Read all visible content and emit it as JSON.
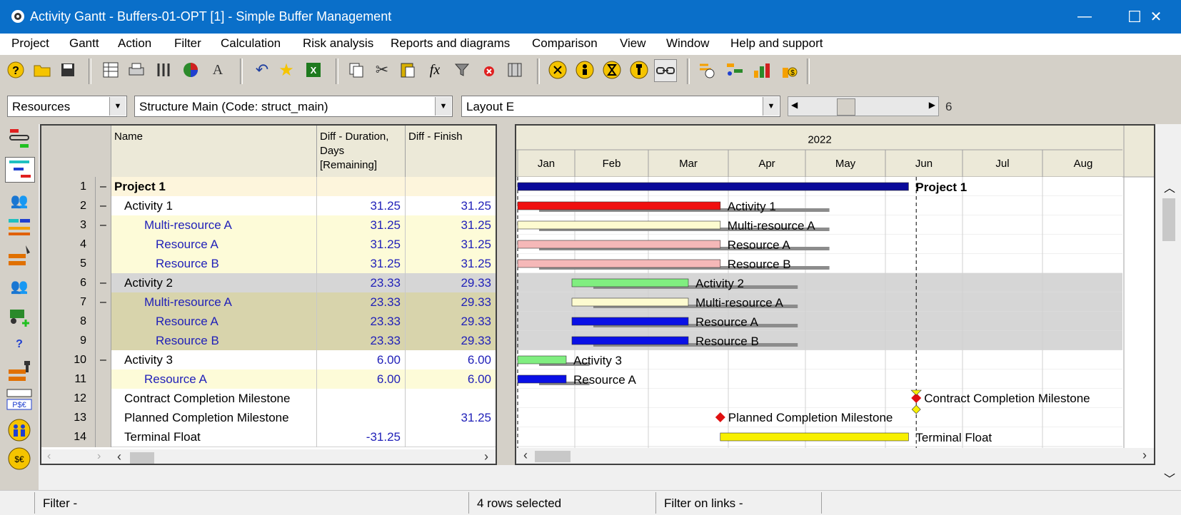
{
  "window": {
    "title": "Activity Gantt - Buffers-01-OPT [1] - Simple Buffer Management",
    "minimize": "—",
    "maximize": "☐",
    "close": "✕"
  },
  "menu": [
    "Project",
    "Gantt",
    "Action",
    "Filter",
    "Calculation",
    "Risk analysis",
    "Reports and diagrams",
    "Comparison",
    "View",
    "Window",
    "Help and support"
  ],
  "selectors": {
    "view": "Resources",
    "structure": "Structure Main (Code: struct_main)",
    "layout": "Layout E",
    "zoom_value": "6"
  },
  "grid": {
    "headers": {
      "name": "Name",
      "duration": "Diff - Duration, Days [Remaining]",
      "finish": "Diff - Finish"
    },
    "rows": [
      {
        "num": "1",
        "collapse": "–",
        "name": "Project 1",
        "dur": "",
        "fin": "",
        "indent": 0,
        "bold": true,
        "bg": "#fdf5dc",
        "color": "#000"
      },
      {
        "num": "2",
        "collapse": "–",
        "name": "Activity 1",
        "dur": "31.25",
        "fin": "31.25",
        "indent": 1,
        "bold": false,
        "bg": "#ffffff",
        "color": "#000"
      },
      {
        "num": "3",
        "collapse": "–",
        "name": "Multi-resource A",
        "dur": "31.25",
        "fin": "31.25",
        "indent": 2,
        "bold": false,
        "bg": "#fdfbd8",
        "color": "#1f1fb8"
      },
      {
        "num": "4",
        "collapse": "",
        "name": "Resource A",
        "dur": "31.25",
        "fin": "31.25",
        "indent": 3,
        "bold": false,
        "bg": "#fdfbd8",
        "color": "#1f1fb8"
      },
      {
        "num": "5",
        "collapse": "",
        "name": "Resource B",
        "dur": "31.25",
        "fin": "31.25",
        "indent": 3,
        "bold": false,
        "bg": "#fdfbd8",
        "color": "#1f1fb8"
      },
      {
        "num": "6",
        "collapse": "–",
        "name": "Activity 2",
        "dur": "23.33",
        "fin": "29.33",
        "indent": 1,
        "bold": false,
        "bg": "#d6d6d6",
        "color": "#000"
      },
      {
        "num": "7",
        "collapse": "–",
        "name": "Multi-resource A",
        "dur": "23.33",
        "fin": "29.33",
        "indent": 2,
        "bold": false,
        "bg": "#d8d4ac",
        "color": "#1f1fb8"
      },
      {
        "num": "8",
        "collapse": "",
        "name": "Resource A",
        "dur": "23.33",
        "fin": "29.33",
        "indent": 3,
        "bold": false,
        "bg": "#d8d4ac",
        "color": "#1f1fb8"
      },
      {
        "num": "9",
        "collapse": "",
        "name": "Resource B",
        "dur": "23.33",
        "fin": "29.33",
        "indent": 3,
        "bold": false,
        "bg": "#d8d4ac",
        "color": "#1f1fb8"
      },
      {
        "num": "10",
        "collapse": "–",
        "name": "Activity 3",
        "dur": "6.00",
        "fin": "6.00",
        "indent": 1,
        "bold": false,
        "bg": "#ffffff",
        "color": "#000"
      },
      {
        "num": "11",
        "collapse": "",
        "name": "Resource A",
        "dur": "6.00",
        "fin": "6.00",
        "indent": 2,
        "bold": false,
        "bg": "#fdfbd8",
        "color": "#1f1fb8"
      },
      {
        "num": "12",
        "collapse": "",
        "name": "Contract Completion Milestone",
        "dur": "",
        "fin": "",
        "indent": 1,
        "bold": false,
        "bg": "#ffffff",
        "color": "#000"
      },
      {
        "num": "13",
        "collapse": "",
        "name": "Planned Completion Milestone",
        "dur": "",
        "fin": "31.25",
        "indent": 1,
        "bold": false,
        "bg": "#ffffff",
        "color": "#000"
      },
      {
        "num": "14",
        "collapse": "",
        "name": "Terminal Float",
        "dur": "-31.25",
        "fin": "",
        "indent": 1,
        "bold": false,
        "bg": "#ffffff",
        "color": "#000"
      }
    ]
  },
  "gantt": {
    "year": "2022",
    "months": [
      "Jan",
      "Feb",
      "Mar",
      "Apr",
      "May",
      "Jun",
      "Jul",
      "Aug"
    ],
    "bars": [
      {
        "row": 0,
        "label": "Project 1",
        "color": "#0a0a9a",
        "start": 0.0,
        "end": 5.3,
        "shadow_end": 5.3,
        "bold": true,
        "kind": "summary"
      },
      {
        "row": 1,
        "label": "Activity 1",
        "color": "#f01010",
        "start": 0.0,
        "end": 2.9,
        "shadow_end": 4.3
      },
      {
        "row": 2,
        "label": "Multi-resource A",
        "color": "#fdfbd0",
        "start": 0.0,
        "end": 2.9,
        "shadow_end": 4.3
      },
      {
        "row": 3,
        "label": "Resource A",
        "color": "#f5b8b8",
        "start": 0.0,
        "end": 2.9,
        "shadow_end": 4.3
      },
      {
        "row": 4,
        "label": "Resource B",
        "color": "#f5b8b8",
        "start": 0.0,
        "end": 2.9,
        "shadow_end": 4.3
      },
      {
        "row": 5,
        "label": "Activity 2",
        "color": "#80ee80",
        "start": 0.95,
        "end": 2.5,
        "shadow_end": 3.9
      },
      {
        "row": 6,
        "label": "Multi-resource A",
        "color": "#fdfbd0",
        "start": 0.95,
        "end": 2.5,
        "shadow_end": 3.9
      },
      {
        "row": 7,
        "label": "Resource A",
        "color": "#0a10e6",
        "start": 0.95,
        "end": 2.5,
        "shadow_end": 3.9
      },
      {
        "row": 8,
        "label": "Resource B",
        "color": "#0a10e6",
        "start": 0.95,
        "end": 2.5,
        "shadow_end": 3.9
      },
      {
        "row": 9,
        "label": "Activity 3",
        "color": "#80ee80",
        "start": 0.0,
        "end": 0.85,
        "shadow_end": 1.2
      },
      {
        "row": 10,
        "label": "Resource A",
        "color": "#0a10e6",
        "start": 0.0,
        "end": 0.85,
        "shadow_end": 1.2
      },
      {
        "row": 11,
        "label": "Contract Completion Milestone",
        "color": "#e01010",
        "start": 5.4,
        "end": 5.4,
        "kind": "milestone"
      },
      {
        "row": 12,
        "label": "Planned Completion Milestone",
        "color": "#e01010",
        "start": 2.9,
        "end": 2.9,
        "kind": "milestone"
      },
      {
        "row": 13,
        "label": "Terminal Float",
        "color": "#f8f000",
        "start": 2.9,
        "end": 5.3,
        "shadow_end": 5.3
      }
    ]
  },
  "status": {
    "filter": "Filter -",
    "selected": "4 rows selected",
    "links": "Filter on links -"
  }
}
